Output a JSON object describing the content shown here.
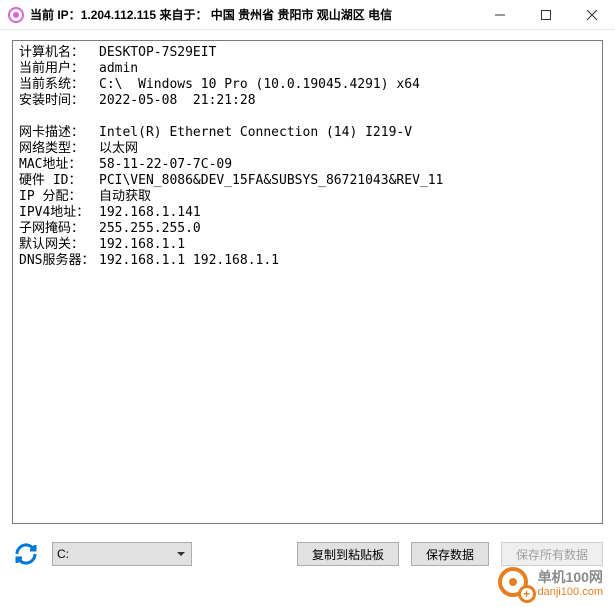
{
  "titlebar": {
    "prefix": "当前 IP：",
    "ip": "1.204.112.115",
    "from_label": "  来自于：  ",
    "location": "中国 贵州省 贵阳市 观山湖区 电信"
  },
  "info": {
    "computer_name_label": "计算机名：",
    "computer_name": "DESKTOP-7S29EIT",
    "current_user_label": "当前用户：",
    "current_user": "admin",
    "os_label": "当前系统：",
    "os": "C:\\  Windows 10 Pro (10.0.19045.4291) x64",
    "install_label": "安装时间：",
    "install": "2022-05-08  21:21:28",
    "nic_desc_label": "网卡描述：",
    "nic_desc": "Intel(R) Ethernet Connection (14) I219-V",
    "net_type_label": "网络类型：",
    "net_type": "以太网",
    "mac_label": "MAC地址：",
    "mac": "58-11-22-07-7C-09",
    "hwid_label": "硬件 ID：",
    "hwid": "PCI\\VEN_8086&DEV_15FA&SUBSYS_86721043&REV_11",
    "ip_assign_label": "IP 分配：",
    "ip_assign": "自动获取",
    "ipv4_label": "IPV4地址：",
    "ipv4": "192.168.1.141",
    "subnet_label": "子网掩码：",
    "subnet": "255.255.255.0",
    "gateway_label": "默认网关：",
    "gateway": "192.168.1.1",
    "dns_label": "DNS服务器：",
    "dns": "192.168.1.1 192.168.1.1"
  },
  "bottom": {
    "drive": "C:",
    "copy": "复制到粘贴板",
    "save": "保存数据",
    "save_all": "保存所有数据"
  },
  "watermark": {
    "line1": "单机100网",
    "line2": "danji100.com"
  }
}
